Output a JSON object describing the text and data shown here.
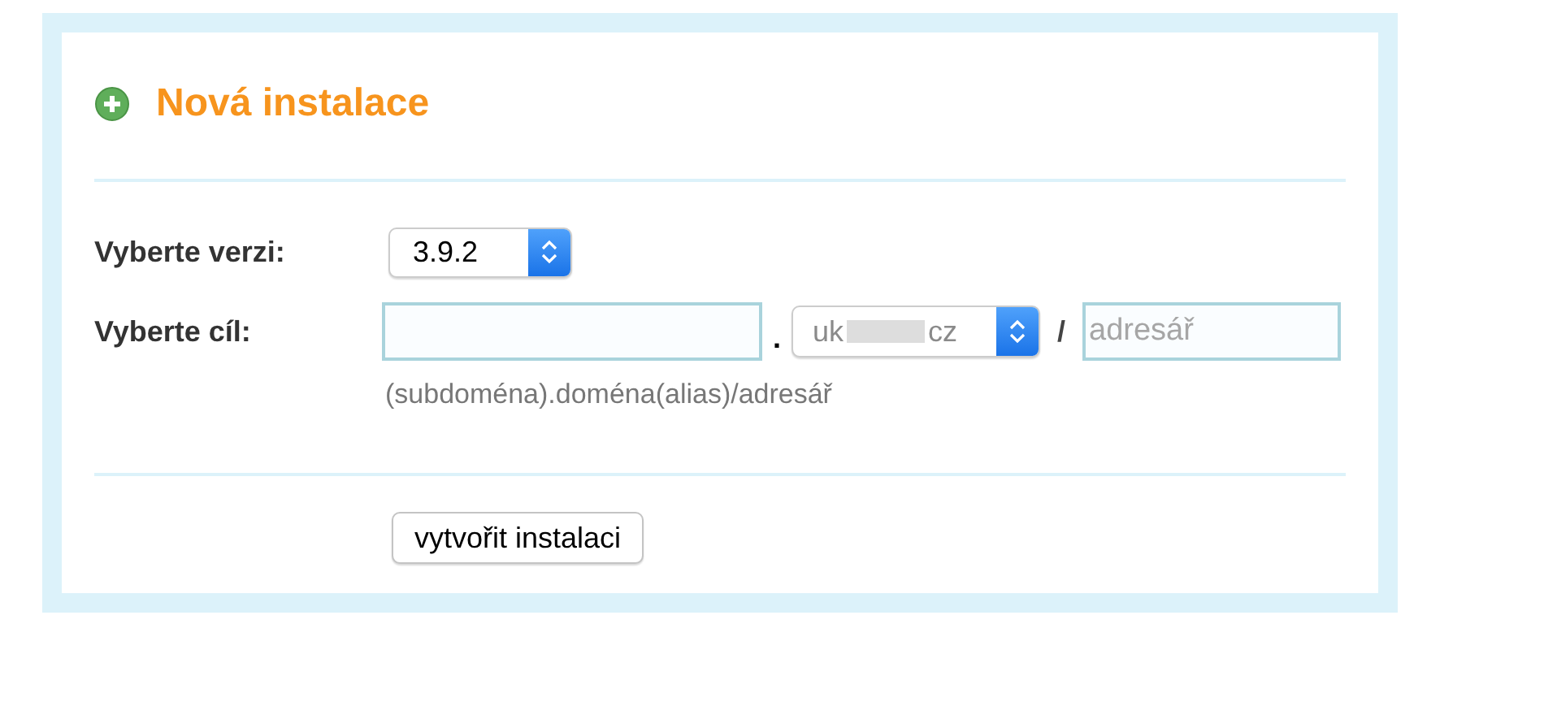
{
  "header": {
    "title": "Nová instalace"
  },
  "version": {
    "label": "Vyberte verzi:",
    "value": "3.9.2"
  },
  "target": {
    "label": "Vyberte cíl:",
    "dot": ".",
    "domain": {
      "value_start": "uk",
      "value_end": "cz"
    },
    "slash": "/",
    "directory": {
      "placeholder": "adresář"
    },
    "hint": "(subdoména).doména(alias)/adresář"
  },
  "submit": {
    "label": "vytvořit instalaci"
  }
}
